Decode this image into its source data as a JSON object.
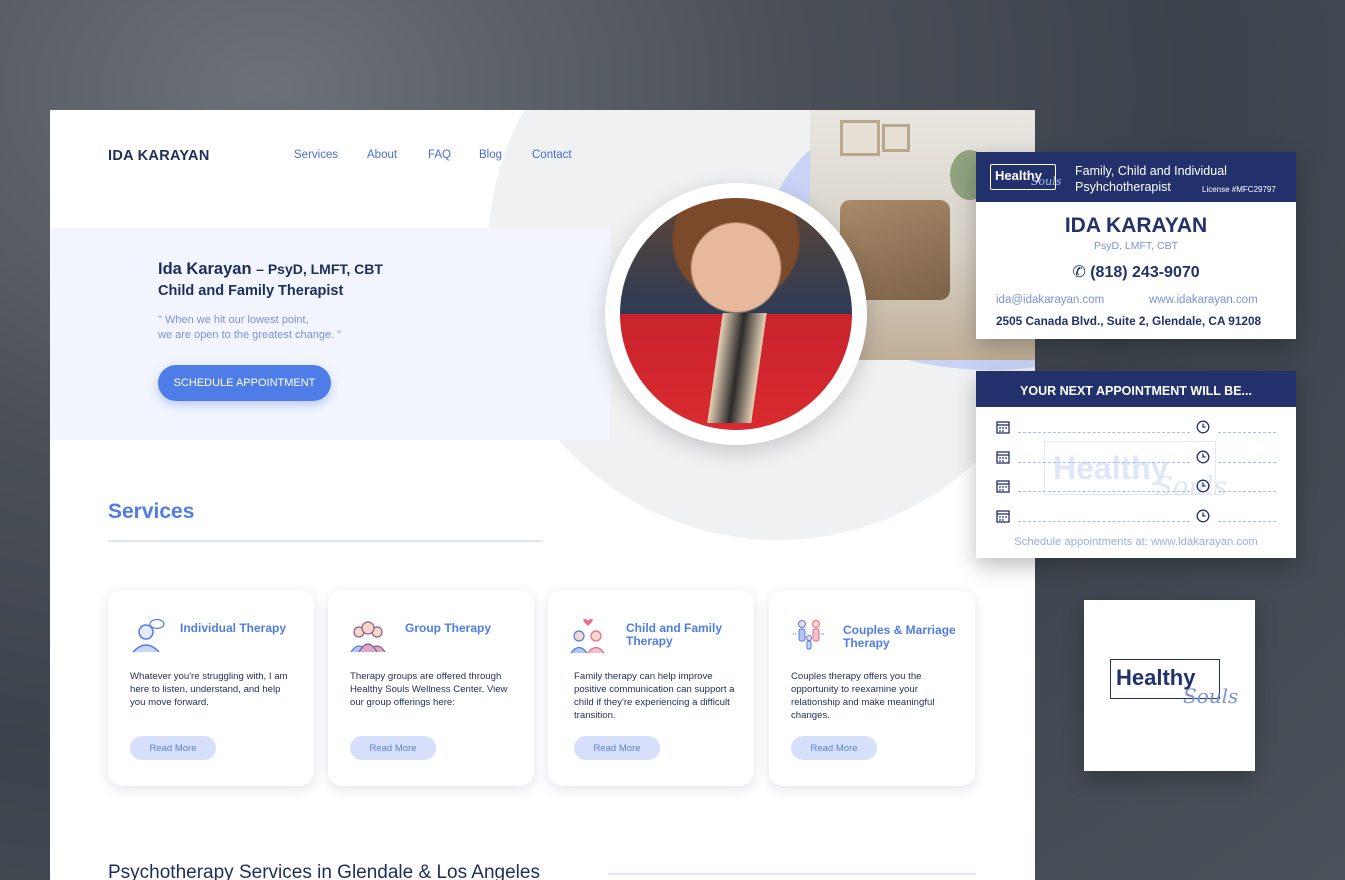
{
  "nav": {
    "brand": "IDA KARAYAN",
    "links": [
      "Services",
      "About",
      "FAQ",
      "Blog",
      "Contact"
    ]
  },
  "hero": {
    "name": "Ida Karayan",
    "credentials": "– PsyD, LMFT, CBT",
    "subtitle": "Child and Family Therapist",
    "quote_line1": "\" When we hit our lowest point,",
    "quote_line2": "we are open to the greatest change. \"",
    "cta_label": "SCHEDULE APPOINTMENT"
  },
  "services": {
    "heading": "Services",
    "cards": [
      {
        "icon": "person-thought-icon",
        "title": "Individual Therapy",
        "body": "Whatever you're struggling with, I am here to listen, understand, and help you move forward.",
        "button": "Read More"
      },
      {
        "icon": "group-icon",
        "title": "Group Therapy",
        "body": "Therapy groups are offered through Healthy Souls Wellness Center. View our group offerings here:",
        "button": "Read More"
      },
      {
        "icon": "family-heart-icon",
        "title": "Child and Family Therapy",
        "body": "Family therapy can help improve positive communication can support a child if they're experiencing a difficult transition.",
        "button": "Read More"
      },
      {
        "icon": "couple-child-icon",
        "title": "Couples & Marriage Therapy",
        "body": "Couples therapy offers you the opportunity to reexamine your relationship and make meaningful changes.",
        "button": "Read More"
      }
    ]
  },
  "footer_heading": "Psychotherapy Services in Glendale & Los Angeles",
  "business_card": {
    "logo_main": "Healthy",
    "logo_script": "Souls",
    "tagline_line1": "Family, Child and Individual",
    "tagline_line2": "Psyhchotherapist",
    "license": "License #MFC29797",
    "name": "IDA KARAYAN",
    "credentials": "PsyD, LMFT, CBT",
    "phone": "(818) 243-9070",
    "email": "ida@idakarayan.com",
    "website": "www.idakarayan.com",
    "address": "2505 Canada Blvd., Suite 2, Glendale, CA 91208"
  },
  "appointment_card": {
    "heading": "YOUR NEXT APPOINTMENT WILL BE...",
    "rows": 4,
    "watermark_main": "Healthy",
    "watermark_script": "Souls",
    "footer": "Schedule appointments at: www.idakarayan.com"
  },
  "logo_tile": {
    "main": "Healthy",
    "script": "Souls"
  },
  "colors": {
    "navy": "#22306b",
    "accent_blue": "#4f7de8",
    "light_blue": "#d6e0fb"
  }
}
